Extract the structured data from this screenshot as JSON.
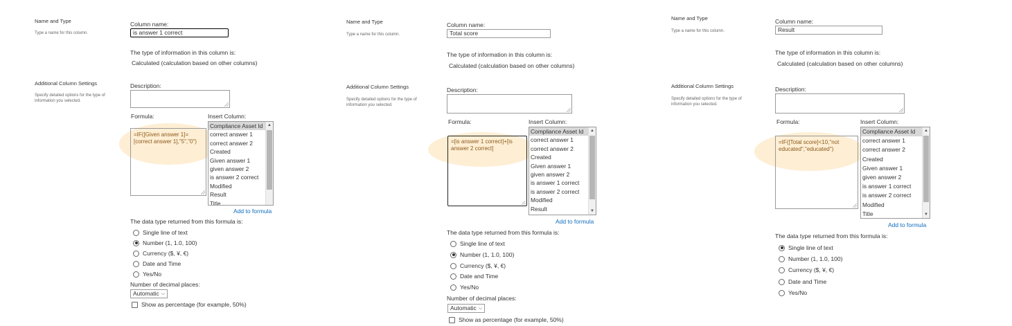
{
  "sections": {
    "name_type_title": "Name and Type",
    "name_type_desc": "Type a name for this column.",
    "additional_title": "Additional Column Settings",
    "additional_desc": "Specify detailed options for the type of information you selected."
  },
  "labels": {
    "column_name": "Column name:",
    "type_info": "The type of information in this column is:",
    "type_value": "Calculated (calculation based on other columns)",
    "description": "Description:",
    "formula": "Formula:",
    "insert_column": "Insert Column:",
    "add_to_formula": "Add to formula",
    "data_type_returned": "The data type returned from this formula is:",
    "decimal_places": "Number of decimal places:",
    "decimal_value": "Automatic",
    "show_percentage": "Show as percentage (for example, 50%)"
  },
  "data_types": [
    "Single line of text",
    "Number (1, 1.0, 100)",
    "Currency ($, ¥, €)",
    "Date and Time",
    "Yes/No"
  ],
  "panels": [
    {
      "column_name": "is answer 1 correct",
      "formula": "=IF([Given answer 1]=\n[correct answer 1],\"5\",\"0\")",
      "insert_columns": [
        "Compliance Asset Id",
        "correct answer 1",
        "correct answer 2",
        "Created",
        "Given answer 1",
        "given answer 2",
        "is answer 2 correct",
        "Modified",
        "Result",
        "Title"
      ],
      "selected_type": 1
    },
    {
      "column_name": "Total score",
      "formula": "=[is answer 1 correct]+[is\nanswer 2 correct]",
      "insert_columns": [
        "Compliance Asset Id",
        "correct answer 1",
        "correct answer 2",
        "Created",
        "Given answer 1",
        "given answer 2",
        "is answer 1 correct",
        "is answer 2 correct",
        "Modified",
        "Result"
      ],
      "selected_type": 1
    },
    {
      "column_name": "Result",
      "formula": "=IF([Total score]<10,\"not\neducated\",\"educated\")",
      "insert_columns": [
        "Compliance Asset Id",
        "correct answer 1",
        "correct answer 2",
        "Created",
        "Given answer 1",
        "given answer 2",
        "is answer 1 correct",
        "is answer 2 correct",
        "Modified",
        "Title"
      ],
      "selected_type": 0
    }
  ]
}
